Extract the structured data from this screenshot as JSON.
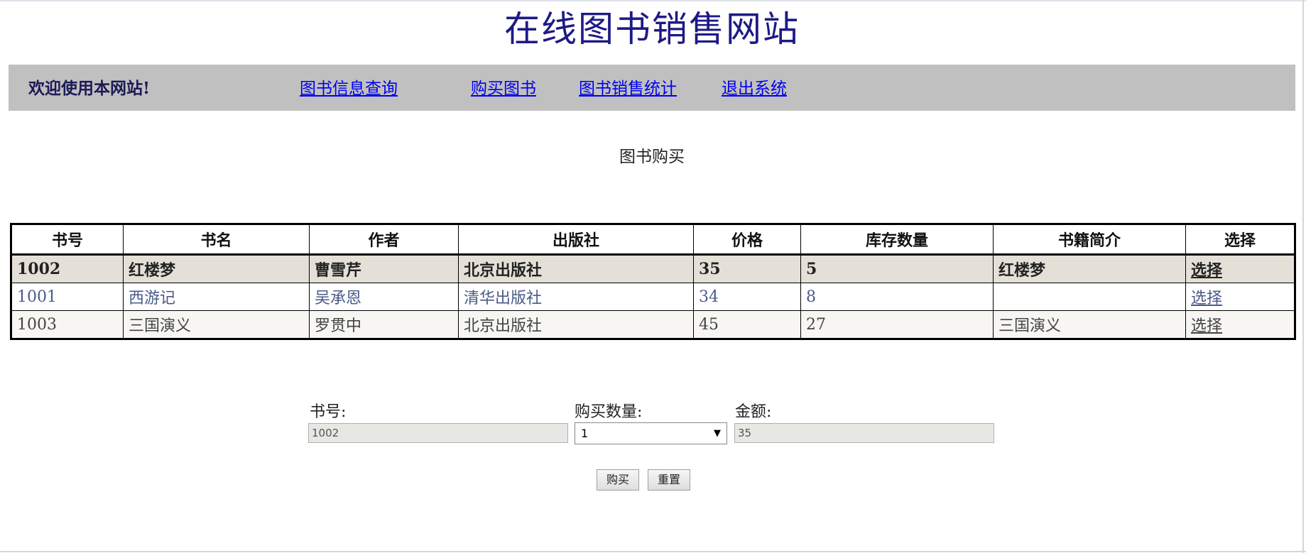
{
  "site_title": "在线图书销售网站",
  "nav": {
    "welcome": "欢迎使用本网站!",
    "links": [
      "图书信息查询",
      "购买图书",
      "图书销售统计",
      "退出系统"
    ]
  },
  "section_title": "图书购买",
  "table": {
    "headers": [
      "书号",
      "书名",
      "作者",
      "出版社",
      "价格",
      "库存数量",
      "书籍简介",
      "选择"
    ],
    "rows": [
      [
        "1002",
        "红楼梦",
        "曹雪芹",
        "北京出版社",
        "35",
        "5",
        "红楼梦",
        "选择"
      ],
      [
        "1001",
        "西游记",
        "吴承恩",
        "清华出版社",
        "34",
        "8",
        "",
        "选择"
      ],
      [
        "1003",
        "三国演义",
        "罗贯中",
        "北京出版社",
        "45",
        "27",
        "三国演义",
        "选择"
      ]
    ],
    "selected_row": 0
  },
  "form": {
    "book_id_label": "书号:",
    "book_id_value": "1002",
    "quantity_label": "购买数量:",
    "quantity_value": "1",
    "amount_label": "金额:",
    "amount_value": "35",
    "buy_button": "购买",
    "reset_button": "重置"
  },
  "colors": {
    "title": "#1d1a86",
    "navbar_bg": "#c0c0c0",
    "link": "#0000ee",
    "selected_row_bg": "#e4e0d8"
  }
}
